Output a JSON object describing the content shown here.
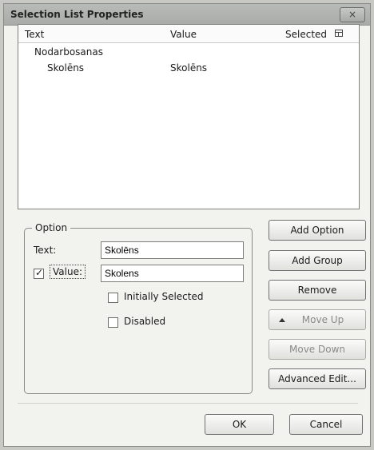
{
  "window": {
    "title": "Selection List Properties",
    "close_label": "×"
  },
  "list": {
    "headers": {
      "text": "Text",
      "value": "Value",
      "selected": "Selected"
    },
    "rows": [
      {
        "text": "Nodarbosanas",
        "value": ""
      },
      {
        "text": "Skolēns",
        "value": "Skolēns"
      }
    ]
  },
  "option_group": {
    "legend": "Option",
    "text_label": "Text:",
    "text_value": "Skolēns",
    "value_label": "Value:",
    "value_checked": true,
    "value_value": "Skolens",
    "initially_selected_label": "Initially Selected",
    "disabled_label": "Disabled"
  },
  "buttons": {
    "add_option": "Add Option",
    "add_group": "Add Group",
    "remove": "Remove",
    "move_up": "Move Up",
    "move_down": "Move Down",
    "advanced_edit": "Advanced Edit...",
    "ok": "OK",
    "cancel": "Cancel"
  },
  "icons": {
    "column_chooser": "column-chooser-icon",
    "close": "close-icon"
  }
}
